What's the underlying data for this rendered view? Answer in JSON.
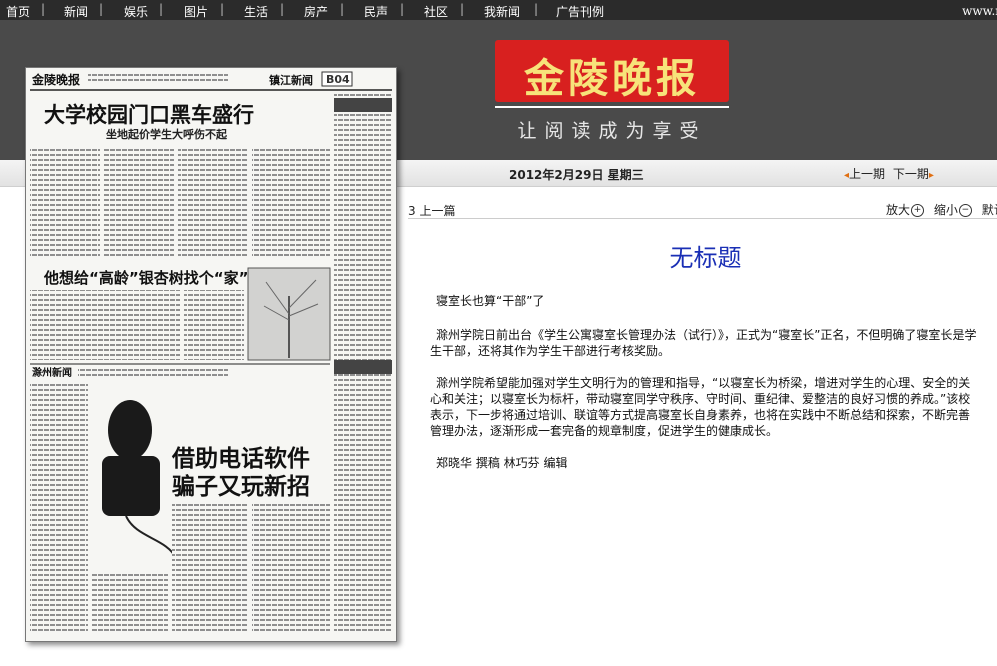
{
  "nav": {
    "items": [
      "首页",
      "新闻",
      "娱乐",
      "图片",
      "生活",
      "房产",
      "民声",
      "社区",
      "我新闻",
      "广告刊例"
    ],
    "url": "www.n"
  },
  "logo": {
    "name": "金陵晚报",
    "slogan": "让阅读成为享受"
  },
  "date": "2012年2月29日  星期三",
  "pager": {
    "prev": "上一期",
    "next": "下一期"
  },
  "paper_page": {
    "masthead": "金陵晚报",
    "section": "镇江新闻",
    "page_no": "B04",
    "headline1": "大学校园门口黑车盛行",
    "sub1": "坐地起价学生大呼伤不起",
    "headline2": "他想给“高龄”银杏树找个“家”",
    "section2": "滁州新闻",
    "headline3a": "借助电话软件",
    "headline3b": "骗子又玩新招"
  },
  "toolbar": {
    "prev_article": "3 上一篇",
    "zoom_in": "放大",
    "zoom_out": "缩小",
    "default": "默认"
  },
  "article": {
    "title": "无标题",
    "subtitle": "寝室长也算“干部”了",
    "p1": "滁州学院日前出台《学生公寓寝室长管理办法（试行）》，正式为“寝室长”正名，不但明确了寝室长是学生干部，还将其作为学生干部进行考核奖励。",
    "p2": "滁州学院希望能加强对学生文明行为的管理和指导，“以寝室长为桥梁，增进对学生的心理、安全的关心和关注；以寝室长为标杆，带动寝室同学守秩序、守时间、重纪律、爱整洁的良好习惯的养成。”该校表示，下一步将通过培训、联谊等方式提高寝室长自身素养，也将在实践中不断总结和探索，不断完善管理办法，逐渐形成一套完备的规章制度，促进学生的健康成长。",
    "byline": "郑晓华  撰稿  林巧芬  编辑"
  }
}
